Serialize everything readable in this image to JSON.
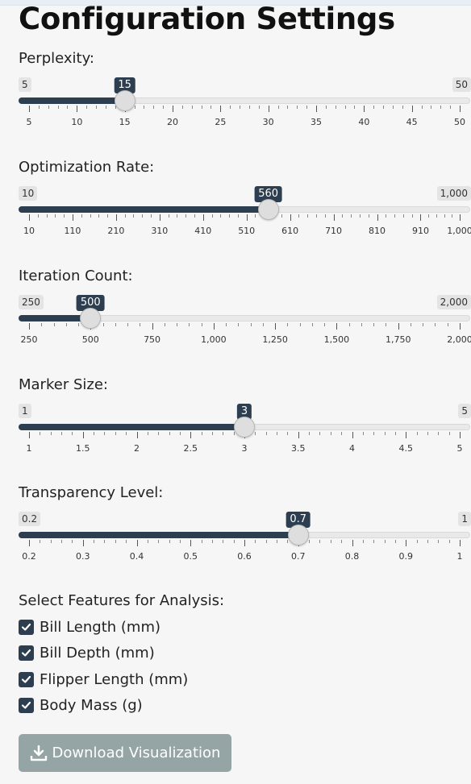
{
  "page": {
    "title": "Configuration Settings"
  },
  "sliders": [
    {
      "id": "perplexity",
      "label": "Perplexity:",
      "min": 5,
      "max": 50,
      "value": 15,
      "min_text": "5",
      "max_text": "50",
      "value_text": "15",
      "major_ticks": [
        "5",
        "10",
        "15",
        "20",
        "25",
        "30",
        "35",
        "40",
        "45",
        "50"
      ],
      "minor_per_major": 4
    },
    {
      "id": "optimization-rate",
      "label": "Optimization Rate:",
      "min": 10,
      "max": 1000,
      "value": 560,
      "min_text": "10",
      "max_text": "1,000",
      "value_text": "560",
      "major_ticks": [
        "10",
        "110",
        "210",
        "310",
        "410",
        "510",
        "610",
        "710",
        "810",
        "910",
        "1,000"
      ],
      "minor_per_major": 4,
      "last_major_value": 1000
    },
    {
      "id": "iteration-count",
      "label": "Iteration Count:",
      "min": 250,
      "max": 2000,
      "value": 500,
      "min_text": "250",
      "max_text": "2,000",
      "value_text": "500",
      "major_ticks": [
        "250",
        "500",
        "750",
        "1,000",
        "1,250",
        "1,500",
        "1,750",
        "2,000"
      ],
      "minor_per_major": 4
    },
    {
      "id": "marker-size",
      "label": "Marker Size:",
      "min": 1,
      "max": 5,
      "value": 3,
      "min_text": "1",
      "max_text": "5",
      "value_text": "3",
      "major_ticks": [
        "1",
        "1.5",
        "2",
        "2.5",
        "3",
        "3.5",
        "4",
        "4.5",
        "5"
      ],
      "minor_per_major": 4
    },
    {
      "id": "transparency-level",
      "label": "Transparency Level:",
      "min": 0.2,
      "max": 1,
      "value": 0.7,
      "min_text": "0.2",
      "max_text": "1",
      "value_text": "0.7",
      "major_ticks": [
        "0.2",
        "0.3",
        "0.4",
        "0.5",
        "0.6",
        "0.7",
        "0.8",
        "0.9",
        "1"
      ],
      "minor_per_major": 4
    }
  ],
  "features": {
    "label": "Select Features for Analysis:",
    "items": [
      {
        "label": "Bill Length (mm)",
        "checked": true
      },
      {
        "label": "Bill Depth (mm)",
        "checked": true
      },
      {
        "label": "Flipper Length (mm)",
        "checked": true
      },
      {
        "label": "Body Mass (g)",
        "checked": true
      }
    ]
  },
  "download": {
    "label": "Download Visualization",
    "icon": "download-icon"
  },
  "colors": {
    "accent": "#2c3e50",
    "button_disabled": "#95a5a6"
  }
}
